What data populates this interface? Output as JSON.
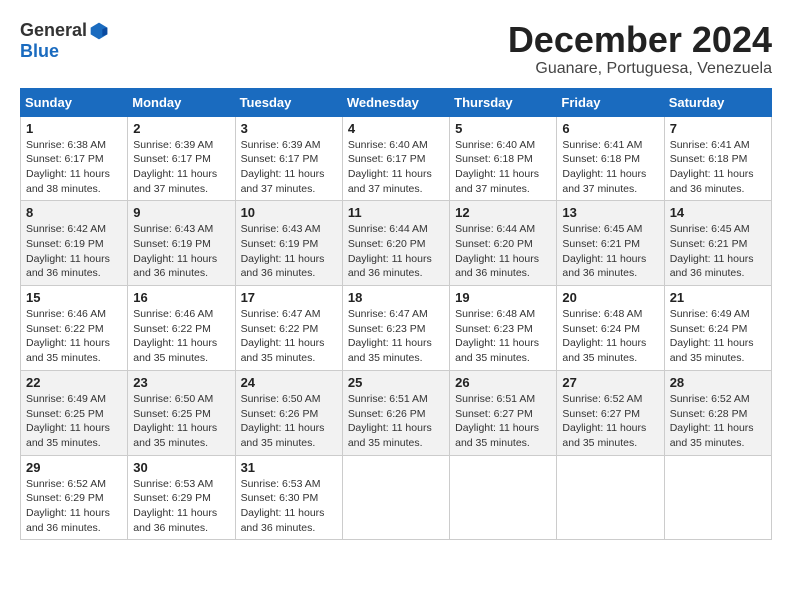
{
  "header": {
    "logo_general": "General",
    "logo_blue": "Blue",
    "main_title": "December 2024",
    "subtitle": "Guanare, Portuguesa, Venezuela"
  },
  "calendar": {
    "days_of_week": [
      "Sunday",
      "Monday",
      "Tuesday",
      "Wednesday",
      "Thursday",
      "Friday",
      "Saturday"
    ],
    "weeks": [
      [
        null,
        {
          "day": "2",
          "sunrise": "6:39 AM",
          "sunset": "6:17 PM",
          "daylight": "11 hours and 37 minutes."
        },
        {
          "day": "3",
          "sunrise": "6:39 AM",
          "sunset": "6:17 PM",
          "daylight": "11 hours and 37 minutes."
        },
        {
          "day": "4",
          "sunrise": "6:40 AM",
          "sunset": "6:17 PM",
          "daylight": "11 hours and 37 minutes."
        },
        {
          "day": "5",
          "sunrise": "6:40 AM",
          "sunset": "6:18 PM",
          "daylight": "11 hours and 37 minutes."
        },
        {
          "day": "6",
          "sunrise": "6:41 AM",
          "sunset": "6:18 PM",
          "daylight": "11 hours and 37 minutes."
        },
        {
          "day": "7",
          "sunrise": "6:41 AM",
          "sunset": "6:18 PM",
          "daylight": "11 hours and 36 minutes."
        }
      ],
      [
        {
          "day": "1",
          "sunrise": "6:38 AM",
          "sunset": "6:17 PM",
          "daylight": "11 hours and 38 minutes."
        },
        {
          "day": "8",
          "sunrise": "6:42 AM",
          "sunset": "6:19 PM",
          "daylight": "11 hours and 36 minutes."
        },
        {
          "day": "9",
          "sunrise": "6:43 AM",
          "sunset": "6:19 PM",
          "daylight": "11 hours and 36 minutes."
        },
        {
          "day": "10",
          "sunrise": "6:43 AM",
          "sunset": "6:19 PM",
          "daylight": "11 hours and 36 minutes."
        },
        {
          "day": "11",
          "sunrise": "6:44 AM",
          "sunset": "6:20 PM",
          "daylight": "11 hours and 36 minutes."
        },
        {
          "day": "12",
          "sunrise": "6:44 AM",
          "sunset": "6:20 PM",
          "daylight": "11 hours and 36 minutes."
        },
        {
          "day": "13",
          "sunrise": "6:45 AM",
          "sunset": "6:21 PM",
          "daylight": "11 hours and 36 minutes."
        },
        {
          "day": "14",
          "sunrise": "6:45 AM",
          "sunset": "6:21 PM",
          "daylight": "11 hours and 36 minutes."
        }
      ],
      [
        {
          "day": "15",
          "sunrise": "6:46 AM",
          "sunset": "6:22 PM",
          "daylight": "11 hours and 35 minutes."
        },
        {
          "day": "16",
          "sunrise": "6:46 AM",
          "sunset": "6:22 PM",
          "daylight": "11 hours and 35 minutes."
        },
        {
          "day": "17",
          "sunrise": "6:47 AM",
          "sunset": "6:22 PM",
          "daylight": "11 hours and 35 minutes."
        },
        {
          "day": "18",
          "sunrise": "6:47 AM",
          "sunset": "6:23 PM",
          "daylight": "11 hours and 35 minutes."
        },
        {
          "day": "19",
          "sunrise": "6:48 AM",
          "sunset": "6:23 PM",
          "daylight": "11 hours and 35 minutes."
        },
        {
          "day": "20",
          "sunrise": "6:48 AM",
          "sunset": "6:24 PM",
          "daylight": "11 hours and 35 minutes."
        },
        {
          "day": "21",
          "sunrise": "6:49 AM",
          "sunset": "6:24 PM",
          "daylight": "11 hours and 35 minutes."
        }
      ],
      [
        {
          "day": "22",
          "sunrise": "6:49 AM",
          "sunset": "6:25 PM",
          "daylight": "11 hours and 35 minutes."
        },
        {
          "day": "23",
          "sunrise": "6:50 AM",
          "sunset": "6:25 PM",
          "daylight": "11 hours and 35 minutes."
        },
        {
          "day": "24",
          "sunrise": "6:50 AM",
          "sunset": "6:26 PM",
          "daylight": "11 hours and 35 minutes."
        },
        {
          "day": "25",
          "sunrise": "6:51 AM",
          "sunset": "6:26 PM",
          "daylight": "11 hours and 35 minutes."
        },
        {
          "day": "26",
          "sunrise": "6:51 AM",
          "sunset": "6:27 PM",
          "daylight": "11 hours and 35 minutes."
        },
        {
          "day": "27",
          "sunrise": "6:52 AM",
          "sunset": "6:27 PM",
          "daylight": "11 hours and 35 minutes."
        },
        {
          "day": "28",
          "sunrise": "6:52 AM",
          "sunset": "6:28 PM",
          "daylight": "11 hours and 35 minutes."
        }
      ],
      [
        {
          "day": "29",
          "sunrise": "6:52 AM",
          "sunset": "6:29 PM",
          "daylight": "11 hours and 36 minutes."
        },
        {
          "day": "30",
          "sunrise": "6:53 AM",
          "sunset": "6:29 PM",
          "daylight": "11 hours and 36 minutes."
        },
        {
          "day": "31",
          "sunrise": "6:53 AM",
          "sunset": "6:30 PM",
          "daylight": "11 hours and 36 minutes."
        },
        null,
        null,
        null,
        null
      ]
    ]
  }
}
